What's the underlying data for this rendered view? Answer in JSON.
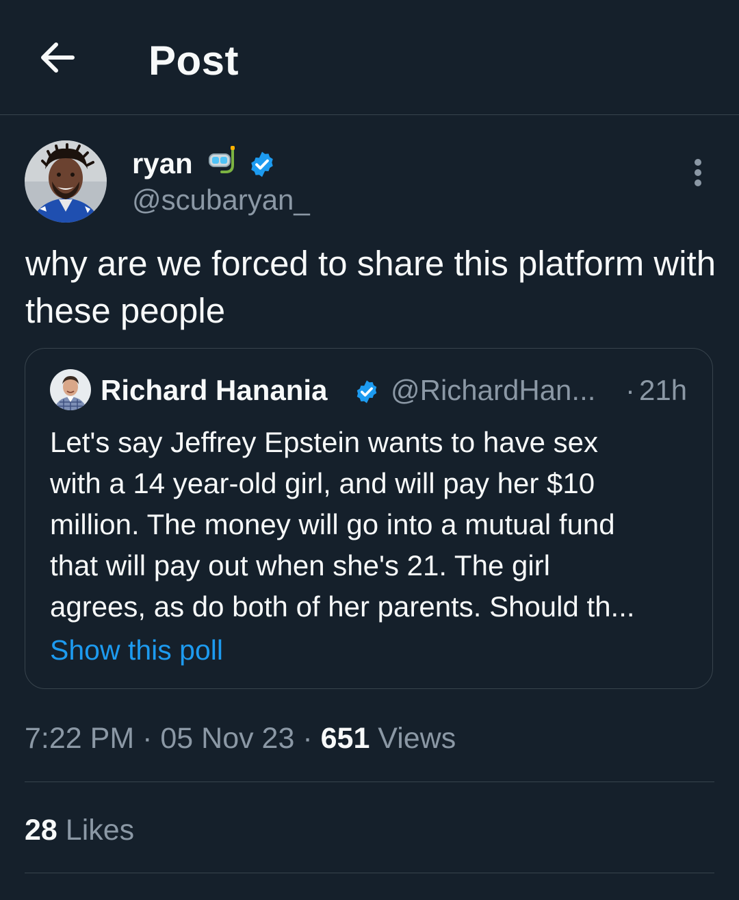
{
  "header": {
    "title": "Post",
    "back_icon": "arrow-left-icon"
  },
  "post": {
    "author": {
      "display_name": "ryan",
      "emoji_icon": "snorkel-mask-icon",
      "verified_icon": "verified-badge-icon",
      "handle": "@scubaryan_"
    },
    "more_icon": "more-vertical-icon",
    "text": "why are we forced to share this platform with these people",
    "quote": {
      "display_name": "Richard Hanania",
      "verified_icon": "verified-badge-icon",
      "handle": "@RichardHan...",
      "separator": "·",
      "time": "21h",
      "text_lines": [
        "Let's say Jeffrey Epstein wants to have sex",
        "with a 14 year-old girl, and will pay her $10",
        "million. The money will go into a mutual fund",
        "that will pay out when she's 21. The girl",
        "agrees, as do both of her parents. Should th..."
      ],
      "show_poll_label": "Show this poll"
    },
    "meta": {
      "time": "7:22 PM",
      "sep1": " · ",
      "date": "05 Nov 23",
      "sep2": " · ",
      "views_count": "651",
      "views_label": " Views"
    },
    "likes": {
      "count": "28",
      "label": " Likes"
    }
  },
  "colors": {
    "background": "#15202b",
    "text_primary": "#f7f9f9",
    "text_secondary": "#8b98a5",
    "accent": "#1d9bf0",
    "border": "#38444d"
  }
}
